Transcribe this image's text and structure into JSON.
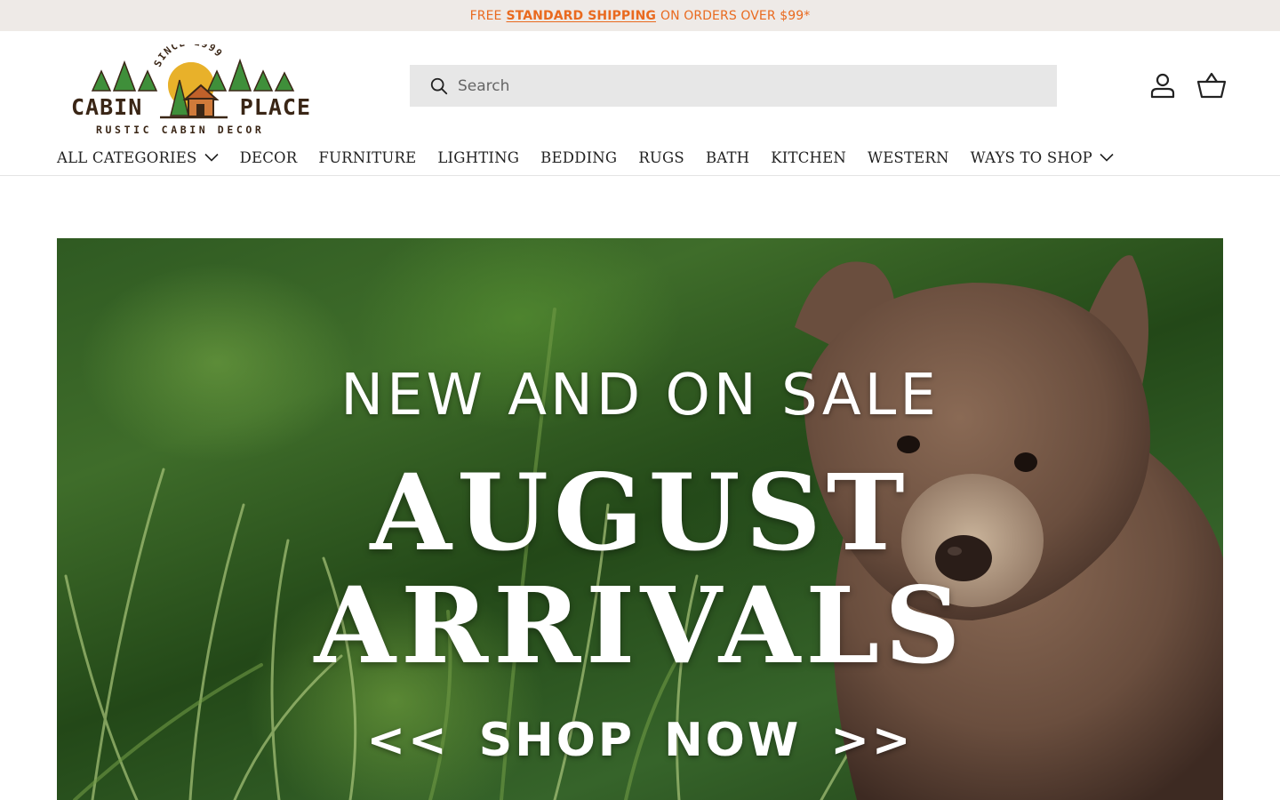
{
  "announcement": {
    "prefix": "FREE",
    "link": "STANDARD SHIPPING",
    "suffix": "ON ORDERS OVER $99*",
    "color": "#e96a1f"
  },
  "logo": {
    "since": "SINCE 1999",
    "word_left": "CABIN",
    "word_right": "PLACE",
    "tagline": "RUSTIC CABIN DECOR",
    "colors": {
      "tree": "#3f8f3a",
      "sun": "#e8b12a",
      "brown": "#3a2616"
    }
  },
  "search": {
    "placeholder": "Search",
    "icon": "search-icon"
  },
  "header_icons": [
    {
      "name": "account-icon",
      "label": "Log in"
    },
    {
      "name": "basket-icon",
      "label": "Cart"
    }
  ],
  "nav": {
    "items": [
      {
        "label": "ALL CATEGORIES",
        "dropdown": true
      },
      {
        "label": "DECOR",
        "dropdown": false
      },
      {
        "label": "FURNITURE",
        "dropdown": false
      },
      {
        "label": "LIGHTING",
        "dropdown": false
      },
      {
        "label": "BEDDING",
        "dropdown": false
      },
      {
        "label": "RUGS",
        "dropdown": false
      },
      {
        "label": "BATH",
        "dropdown": false
      },
      {
        "label": "KITCHEN",
        "dropdown": false
      },
      {
        "label": "WESTERN",
        "dropdown": false
      },
      {
        "label": "WAYS TO SHOP",
        "dropdown": true
      }
    ]
  },
  "hero": {
    "kicker": "NEW AND ON SALE",
    "title_line1": "AUGUST",
    "title_line2": "ARRIVALS",
    "cta": "<< SHOP NOW >>"
  }
}
